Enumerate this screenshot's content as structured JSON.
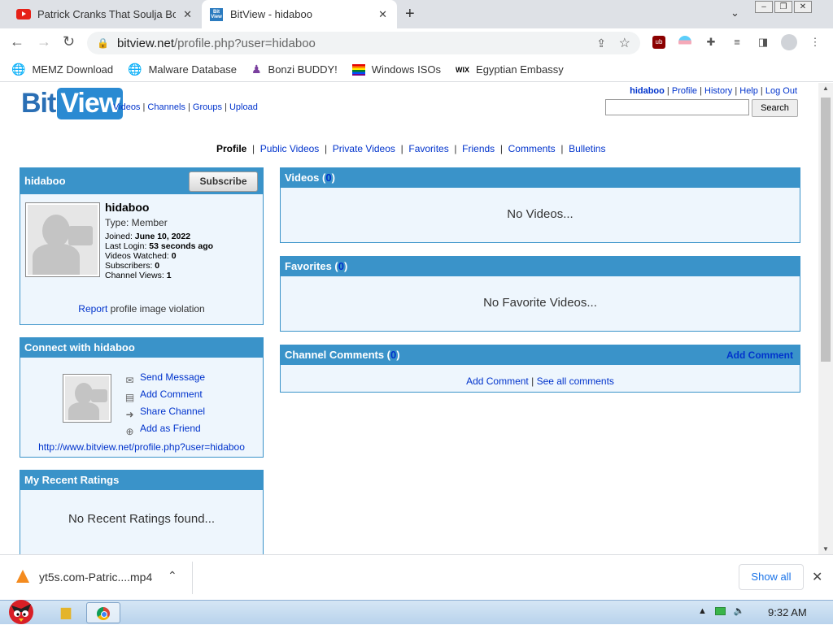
{
  "browser": {
    "tabs": [
      {
        "title": "Patrick Cranks That Soulja Boy",
        "icon": "youtube-icon"
      },
      {
        "title": "BitView - hidaboo",
        "icon": "bitview-icon",
        "favicon_text": "Bit View"
      }
    ],
    "url_host": "bitview.net",
    "url_path": "/profile.php?user=hidaboo",
    "bookmarks": [
      {
        "label": "MEMZ Download",
        "icon": "globe-icon"
      },
      {
        "label": "Malware Database",
        "icon": "globe-icon"
      },
      {
        "label": "Bonzi BUDDY!",
        "icon": "bonzi-icon"
      },
      {
        "label": "Windows ISOs",
        "icon": "rainbow-flag-icon"
      },
      {
        "label": "Egyptian Embassy",
        "icon": "wix-icon",
        "icon_text": "WIX"
      }
    ]
  },
  "site": {
    "logo_part1": "Bit",
    "logo_part2": "View",
    "nav": [
      "Videos",
      "Channels",
      "Groups",
      "Upload"
    ],
    "user_links": [
      "hidaboo",
      "Profile",
      "History",
      "Help",
      "Log Out"
    ],
    "search_placeholder": "",
    "search_button": "Search",
    "subnav": [
      "Profile",
      "Public Videos",
      "Private Videos",
      "Favorites",
      "Friends",
      "Comments",
      "Bulletins"
    ]
  },
  "profile": {
    "header": "hidaboo",
    "subscribe_label": "Subscribe",
    "name": "hidaboo",
    "type": "Type: Member",
    "joined_label": "Joined: ",
    "joined_value": "June 10, 2022",
    "last_login_label": "Last Login: ",
    "last_login_value": "53 seconds ago",
    "videos_watched_label": "Videos Watched: ",
    "videos_watched_value": "0",
    "subscribers_label": "Subscribers: ",
    "subscribers_value": "0",
    "channel_views_label": "Channel Views: ",
    "channel_views_value": "1",
    "report_link": "Report",
    "report_text": " profile image violation"
  },
  "connect": {
    "header": "Connect with hidaboo",
    "links": [
      {
        "label": "Send Message",
        "icon": "envelope-icon"
      },
      {
        "label": "Add Comment",
        "icon": "comment-icon"
      },
      {
        "label": "Share Channel",
        "icon": "share-arrow-icon"
      },
      {
        "label": "Add as Friend",
        "icon": "add-friend-icon"
      }
    ],
    "url": "http://www.bitview.net/profile.php?user=hidaboo"
  },
  "ratings": {
    "header": "My Recent Ratings",
    "empty": "No Recent Ratings found..."
  },
  "videos": {
    "header": "Videos (",
    "count": "0",
    "header_end": ")",
    "empty": "No Videos..."
  },
  "favorites": {
    "header": "Favorites (",
    "count": "0",
    "header_end": ")",
    "empty": "No Favorite Videos..."
  },
  "comments": {
    "header": "Channel Comments (",
    "count": "0",
    "header_end": ")",
    "add_comment_header": "Add Comment",
    "add_comment": "Add Comment",
    "see_all": "See all comments"
  },
  "downloads": {
    "file": "yt5s.com-Patric....mp4",
    "show_all": "Show all"
  },
  "taskbar": {
    "clock": "9:32 AM"
  },
  "colors": {
    "box_header": "#3a93c9",
    "box_bg": "#eef6fd",
    "link": "#0033cc"
  }
}
